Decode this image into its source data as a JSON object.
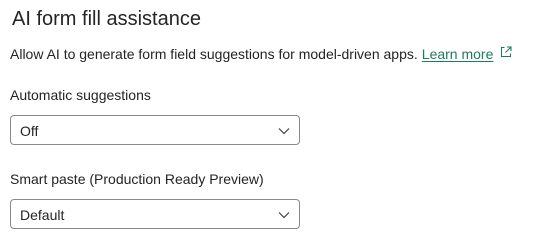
{
  "panel": {
    "title": "AI form fill assistance",
    "description": "Allow AI to generate form field suggestions for model-driven apps.",
    "learn_more_label": "Learn more",
    "icons": {
      "learn_more": "open-in-new-window-icon",
      "dropdown": "chevron-down-icon"
    }
  },
  "fields": {
    "automatic_suggestions": {
      "label": "Automatic suggestions",
      "selected": "Off"
    },
    "smart_paste": {
      "label": "Smart paste (Production Ready Preview)",
      "selected": "Default"
    }
  },
  "colors": {
    "link": "#1e7b5e",
    "text": "#242424",
    "border": "#8a8886"
  }
}
